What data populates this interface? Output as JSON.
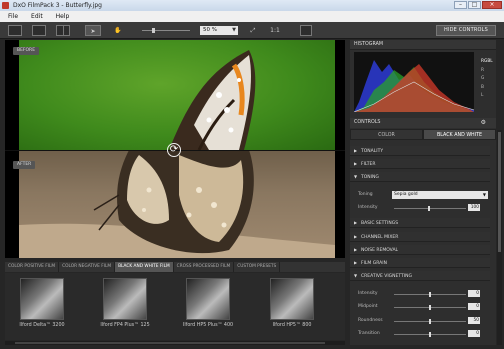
{
  "window": {
    "title": "DxO FilmPack 3 - Butterfly.jpg"
  },
  "menu": [
    "File",
    "Edit",
    "Help"
  ],
  "toolbar": {
    "zoom": "50 %",
    "ratio": "1:1",
    "hide_controls": "HIDE CONTROLS"
  },
  "viewer": {
    "before_label": "BEFORE",
    "after_label": "AFTER"
  },
  "film_tabs": [
    {
      "label": "COLOR POSITIVE FILM",
      "active": false
    },
    {
      "label": "COLOR NEGATIVE FILM",
      "active": false
    },
    {
      "label": "BLACK AND WHITE FILM",
      "active": true
    },
    {
      "label": "CROSS PROCESSED FILM",
      "active": false
    },
    {
      "label": "CUSTOM PRESETS",
      "active": false
    }
  ],
  "thumbnails": [
    "Ilford Delta™ 3200",
    "Ilford FP4 Plus™ 125",
    "Ilford HP5 Plus™ 400",
    "Ilford HP5™ 800"
  ],
  "panel": {
    "histogram_title": "HISTOGRAM",
    "channels": [
      "RGBL",
      "R",
      "G",
      "B",
      "L"
    ],
    "controls_title": "CONTROLS",
    "mode_tabs": [
      "COLOR",
      "BLACK AND WHITE"
    ],
    "sections": {
      "tonality": "TONALITY",
      "filter": "FILTER",
      "toning": "TONING",
      "basic": "BASIC SETTINGS",
      "mixer": "CHANNEL MIXER",
      "noise": "NOISE REMOVAL",
      "grain": "FILM GRAIN",
      "vignetting": "CREATIVE VIGNETTING"
    },
    "toning": {
      "toning_label": "Toning",
      "toning_value": "Sepia gold",
      "intensity_label": "Intensity",
      "intensity_value": "100"
    },
    "vignetting": {
      "intensity_label": "Intensity",
      "intensity_value": "0",
      "midpoint_label": "Midpoint",
      "midpoint_value": "0",
      "roundness_label": "Roundness",
      "roundness_value": "50",
      "transition_label": "Transition",
      "transition_value": "0"
    }
  }
}
